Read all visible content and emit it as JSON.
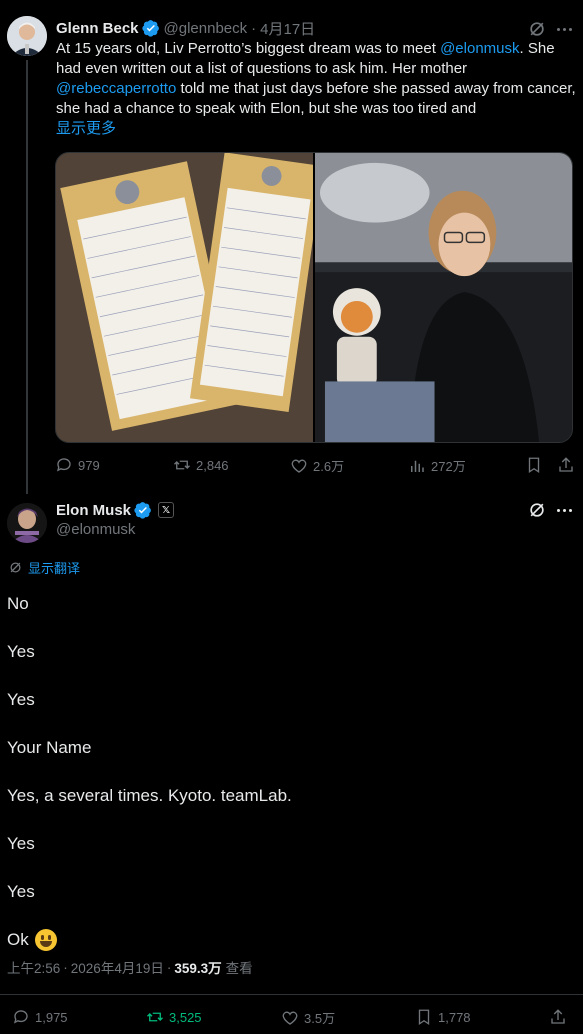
{
  "tweet1": {
    "author_name": "Glenn Beck",
    "handle": "@glennbeck",
    "separator": "·",
    "date": "4月17日",
    "text_part1": "At 15 years old, Liv Perrotto’s biggest dream was to meet ",
    "mention1": "@elonmusk",
    "text_part2": ". She had even written out a list of questions to ask him. Her mother ",
    "mention2": "@rebeccaperrotto",
    "text_part3": " told me that just days before she passed away from cancer, she had a chance to speak with Elon, but she was too tired and",
    "show_more": "显示更多",
    "stats": {
      "replies": "979",
      "retweets": "2,846",
      "likes": "2.6万",
      "views": "272万"
    }
  },
  "tweet2": {
    "author_name": "Elon Musk",
    "handle": "@elonmusk",
    "translate_label": "显示翻译",
    "lines": [
      "No",
      "Yes",
      "Yes",
      "Your Name",
      "Yes, a several times. Kyoto. teamLab.",
      "Yes",
      "Yes",
      "Ok"
    ],
    "time": "上午2:56",
    "separator": "·",
    "date": "2026年4月19日",
    "views_count": "359.3万",
    "views_label": "查看",
    "stats": {
      "replies": "1,975",
      "retweets": "3,525",
      "likes": "3.5万",
      "bookmarks": "1,778"
    }
  },
  "colors": {
    "link": "#1d9bf0",
    "muted": "#71767b",
    "retweeted": "#00ba7c",
    "background": "#000000"
  }
}
